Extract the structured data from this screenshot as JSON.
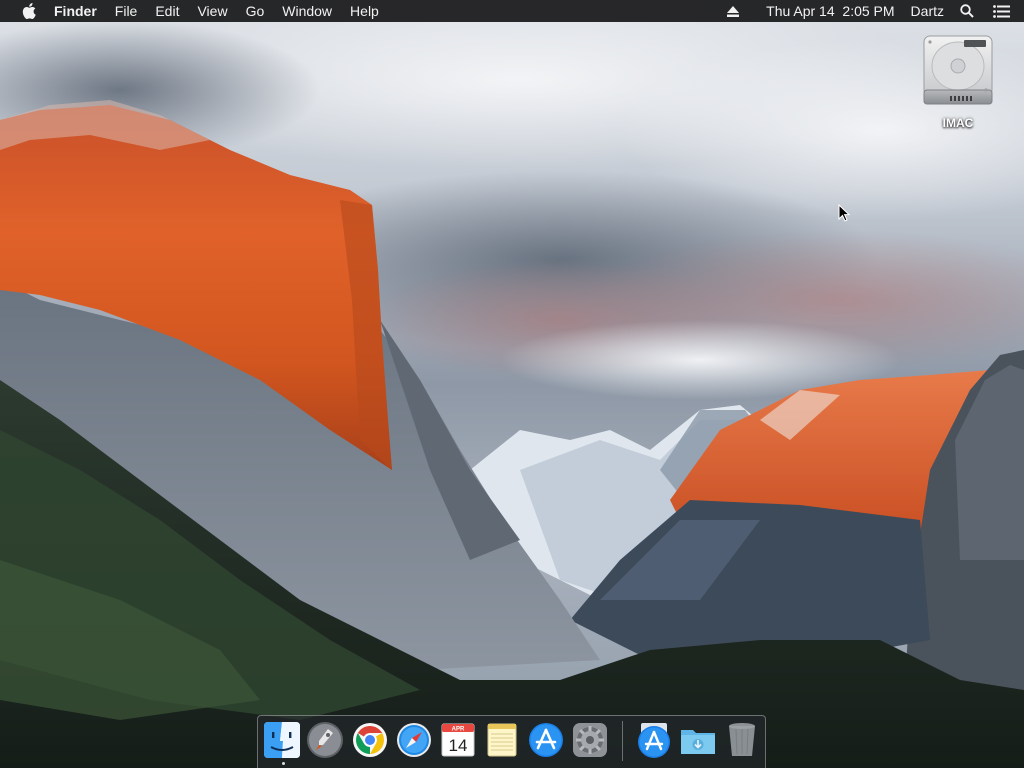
{
  "menubar": {
    "apple_icon": "apple-logo-icon",
    "app_name": "Finder",
    "menus": [
      "File",
      "Edit",
      "View",
      "Go",
      "Window",
      "Help"
    ],
    "eject_icon": "eject-icon",
    "clock": "Thu Apr 14  2:05 PM",
    "user": "Dartz",
    "spotlight_icon": "search-icon",
    "notification_icon": "notification-center-icon"
  },
  "desktop": {
    "wallpaper": "el-capitan-wallpaper",
    "disk": {
      "label": "IMAC",
      "icon": "hard-drive-icon"
    }
  },
  "dock": {
    "apps": [
      {
        "name": "Finder",
        "icon": "finder-icon",
        "running": true
      },
      {
        "name": "Launchpad",
        "icon": "launchpad-icon"
      },
      {
        "name": "Google Chrome",
        "icon": "chrome-icon"
      },
      {
        "name": "Safari",
        "icon": "safari-icon"
      },
      {
        "name": "Calendar",
        "icon": "calendar-icon",
        "month": "APR",
        "day": "14"
      },
      {
        "name": "Notes",
        "icon": "notes-icon"
      },
      {
        "name": "App Store",
        "icon": "app-store-icon"
      },
      {
        "name": "System Preferences",
        "icon": "system-preferences-icon"
      }
    ],
    "stacks": [
      {
        "name": "Applications",
        "icon": "applications-stack-icon"
      },
      {
        "name": "Downloads",
        "icon": "downloads-folder-icon"
      },
      {
        "name": "Trash",
        "icon": "trash-icon"
      }
    ]
  },
  "colors": {
    "menubar_bg": "#0c0c0e",
    "rock_orange": "#d2561f",
    "sky": "#c9d0d8"
  }
}
